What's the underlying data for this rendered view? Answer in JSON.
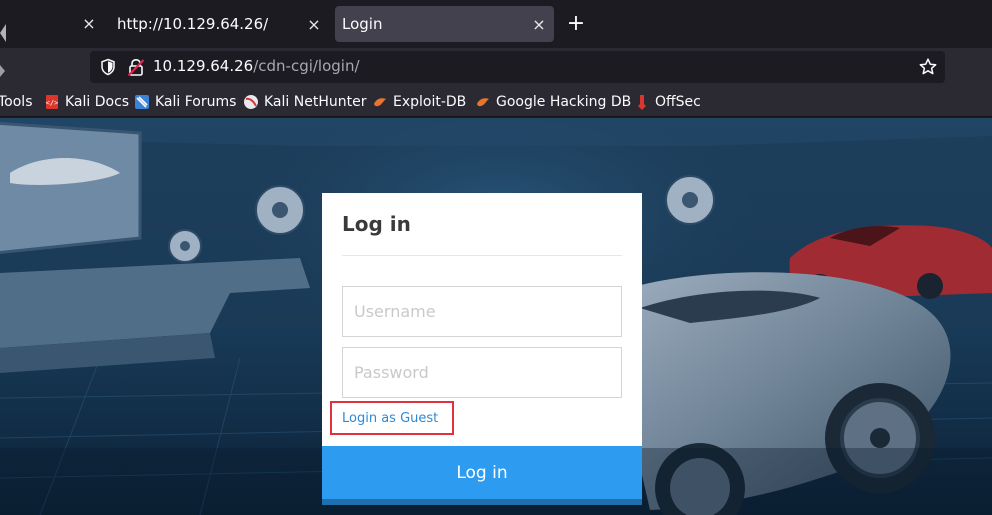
{
  "browser": {
    "tabs": [
      {
        "title": "",
        "active": false
      },
      {
        "title": "http://10.129.64.26/",
        "active": false
      },
      {
        "title": "Login",
        "active": true
      }
    ],
    "close_glyph": "×",
    "new_tab_glyph": "+",
    "url": {
      "host": "10.129.64.26",
      "path": "/cdn-cgi/login/"
    },
    "bookmarks": [
      {
        "label": "Tools",
        "icon": "none"
      },
      {
        "label": "Kali Docs",
        "icon": "kali-docs-icon"
      },
      {
        "label": "Kali Forums",
        "icon": "kali-forums-icon"
      },
      {
        "label": "Kali NetHunter",
        "icon": "kali-nethunter-icon"
      },
      {
        "label": "Exploit-DB",
        "icon": "exploit-db-icon"
      },
      {
        "label": "Google Hacking DB",
        "icon": "ghdb-icon"
      },
      {
        "label": "OffSec",
        "icon": "offsec-icon"
      }
    ]
  },
  "login": {
    "title": "Log in",
    "username_placeholder": "Username",
    "password_placeholder": "Password",
    "guest_link": "Login as Guest",
    "submit_label": "Log in"
  },
  "colors": {
    "accent": "#2d9bf0",
    "highlight_box": "#e0323c",
    "link": "#2b8ad6"
  }
}
